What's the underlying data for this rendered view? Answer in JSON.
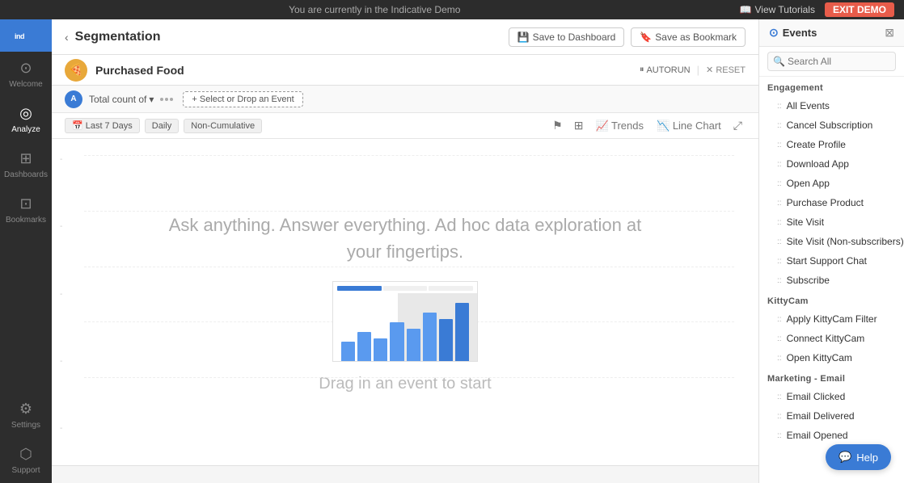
{
  "topbar": {
    "demo_message": "You are currently in the Indicative Demo",
    "view_tutorials_label": "View Tutorials",
    "exit_demo_label": "EXIT DEMO"
  },
  "sidebar": {
    "logo": "indicative",
    "items": [
      {
        "id": "welcome",
        "label": "Welcome",
        "icon": "⊙"
      },
      {
        "id": "analyze",
        "label": "Analyze",
        "icon": "◎"
      },
      {
        "id": "dashboards",
        "label": "Dashboards",
        "icon": "⊞"
      },
      {
        "id": "bookmarks",
        "label": "Bookmarks",
        "icon": "⊡"
      },
      {
        "id": "settings",
        "label": "Settings",
        "icon": "⚙"
      },
      {
        "id": "support",
        "label": "Support",
        "icon": "⬡"
      }
    ]
  },
  "header": {
    "back_label": "‹",
    "title": "Segmentation",
    "save_dashboard_label": "Save to Dashboard",
    "save_bookmark_label": "Save as Bookmark"
  },
  "segment": {
    "icon": "🍕",
    "title": "Purchased Food",
    "autorun_label": "AUTORUN",
    "reset_label": "RESET"
  },
  "filter": {
    "avatar": "A",
    "total_label": "Total count of",
    "chevron": "▾",
    "select_label": "+ Select or Drop an Event"
  },
  "chart_toolbar": {
    "date_range": "Last 7 Days",
    "frequency": "Daily",
    "cumulative": "Non-Cumulative",
    "trends_label": "Trends",
    "line_chart_label": "Line Chart",
    "chart_label": "Chart"
  },
  "chart_area": {
    "placeholder_text": "Ask anything. Answer everything. Ad hoc data exploration at your fingertips.",
    "drag_text": "Drag in an event to start",
    "y_axis_labels": [
      "",
      "",
      "",
      "",
      "",
      ""
    ]
  },
  "events_panel": {
    "title": "Events",
    "search_placeholder": "Search All",
    "close_icon": "⊠",
    "categories": [
      {
        "name": "Engagement",
        "items": [
          "All Events",
          "Cancel Subscription",
          "Create Profile",
          "Download App",
          "Open App",
          "Purchase Product",
          "Site Visit",
          "Site Visit (Non-subscribers)",
          "Start Support Chat",
          "Subscribe"
        ]
      },
      {
        "name": "KittyCam",
        "items": [
          "Apply KittyCam Filter",
          "Connect KittyCam",
          "Open KittyCam"
        ]
      },
      {
        "name": "Marketing - Email",
        "items": [
          "Email Clicked",
          "Email Delivered",
          "Email Opened"
        ]
      }
    ]
  },
  "help": {
    "label": "Help"
  },
  "bottom": {
    "text": ""
  }
}
